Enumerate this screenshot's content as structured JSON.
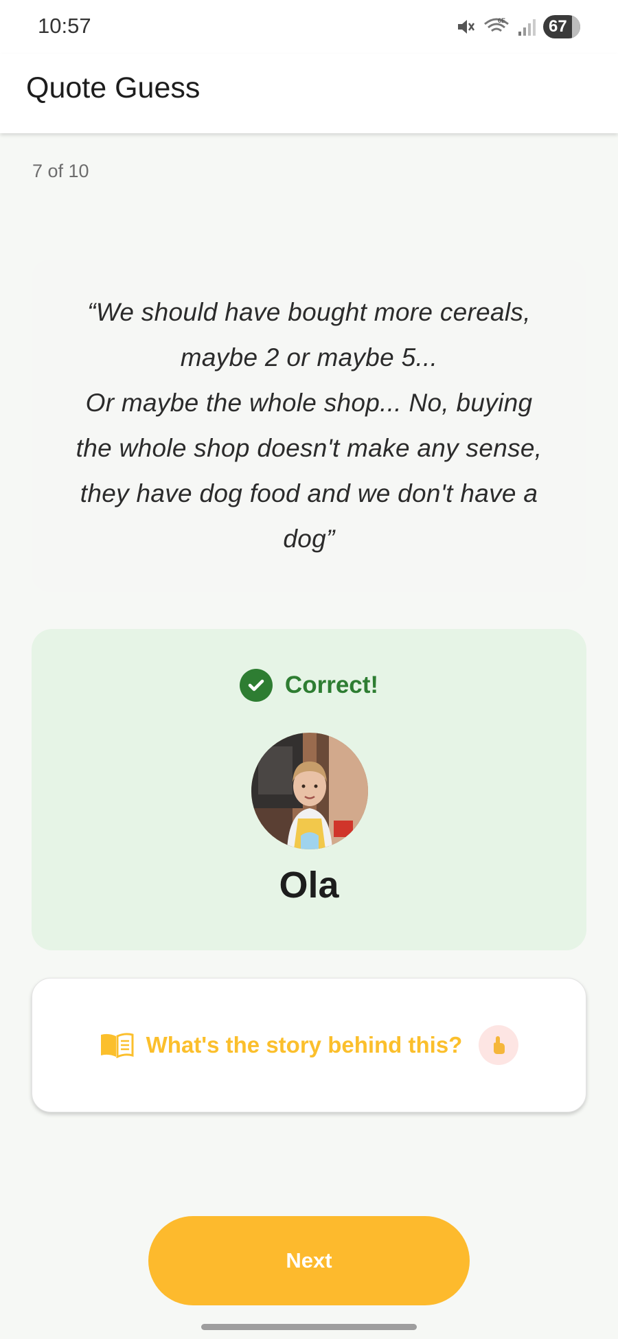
{
  "status_bar": {
    "time": "10:57",
    "battery": "67",
    "icons": [
      "mute-icon",
      "wifi-6e-icon",
      "signal-icon",
      "battery-icon"
    ]
  },
  "app_bar": {
    "title": "Quote Guess"
  },
  "progress": {
    "label": "7 of 10",
    "current": 7,
    "total": 10
  },
  "quote": {
    "text": "“We should have bought more cereals,\nmaybe 2 or maybe 5...\nOr maybe the whole shop... No, buying\nthe whole shop doesn't make any sense,\nthey have dog food and we don't have a\ndog”"
  },
  "result": {
    "label": "Correct!",
    "status_icon": "check-circle-icon",
    "person_name": "Ola",
    "avatar_icon": "person-photo"
  },
  "story": {
    "label": "What's the story behind this?",
    "icon": "book-icon",
    "hint_icon": "tap-hand-icon"
  },
  "actions": {
    "next_label": "Next"
  },
  "colors": {
    "accent": "#fdba2d",
    "story_text": "#fbbf2c",
    "success": "#2e7d32",
    "success_bg": "#e6f4e6",
    "background": "#f6f8f5"
  }
}
